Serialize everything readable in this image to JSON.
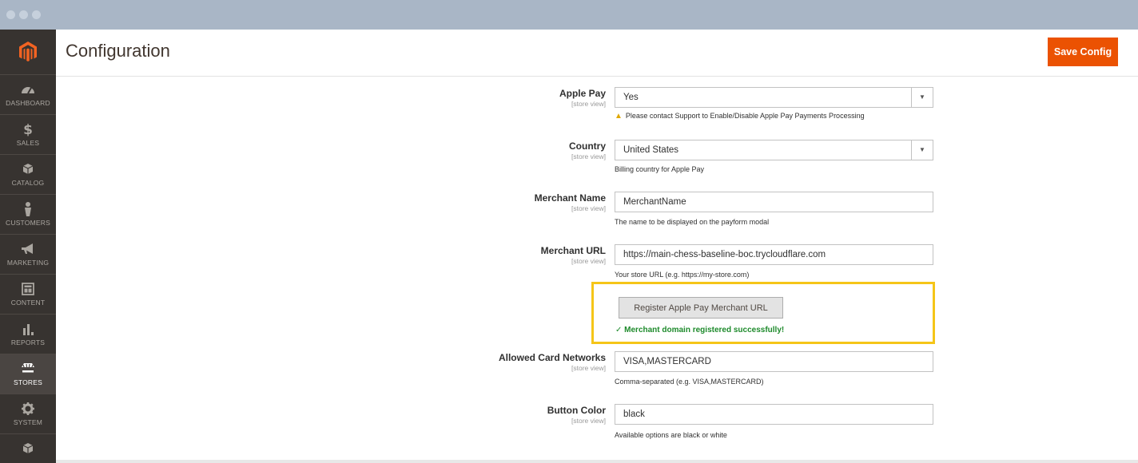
{
  "header": {
    "title": "Configuration",
    "save_label": "Save Config"
  },
  "sidebar": {
    "items": [
      {
        "label": "DASHBOARD",
        "icon": "dashboard-icon"
      },
      {
        "label": "SALES",
        "icon": "dollar-icon"
      },
      {
        "label": "CATALOG",
        "icon": "box-icon"
      },
      {
        "label": "CUSTOMERS",
        "icon": "person-icon"
      },
      {
        "label": "MARKETING",
        "icon": "megaphone-icon"
      },
      {
        "label": "CONTENT",
        "icon": "layout-icon"
      },
      {
        "label": "REPORTS",
        "icon": "bar-chart-icon"
      },
      {
        "label": "STORES",
        "icon": "store-icon",
        "active": true
      },
      {
        "label": "SYSTEM",
        "icon": "gear-icon"
      }
    ]
  },
  "form": {
    "apple_pay": {
      "label": "Apple Pay",
      "scope": "[store view]",
      "value": "Yes",
      "note": "Please contact Support to Enable/Disable Apple Pay Payments Processing"
    },
    "country": {
      "label": "Country",
      "scope": "[store view]",
      "value": "United States",
      "note": "Billing country for Apple Pay"
    },
    "merchant_name": {
      "label": "Merchant Name",
      "scope": "[store view]",
      "value": "MerchantName",
      "note": "The name to be displayed on the payform modal"
    },
    "merchant_url": {
      "label": "Merchant URL",
      "scope": "[store view]",
      "value": "https://main-chess-baseline-boc.trycloudflare.com",
      "note": "Your store URL (e.g. https://my-store.com)"
    },
    "register": {
      "button_label": "Register Apple Pay Merchant URL",
      "success": "✓ Merchant domain registered successfully!"
    },
    "card_networks": {
      "label": "Allowed Card Networks",
      "scope": "[store view]",
      "value": "VISA,MASTERCARD",
      "note": "Comma-separated (e.g. VISA,MASTERCARD)"
    },
    "button_color": {
      "label": "Button Color",
      "scope": "[store view]",
      "value": "black",
      "note": "Available options are black or white"
    }
  },
  "colors": {
    "accent": "#eb5202",
    "sidebar": "#373330",
    "highlight": "#f5c518",
    "success": "#1d8a2b"
  }
}
